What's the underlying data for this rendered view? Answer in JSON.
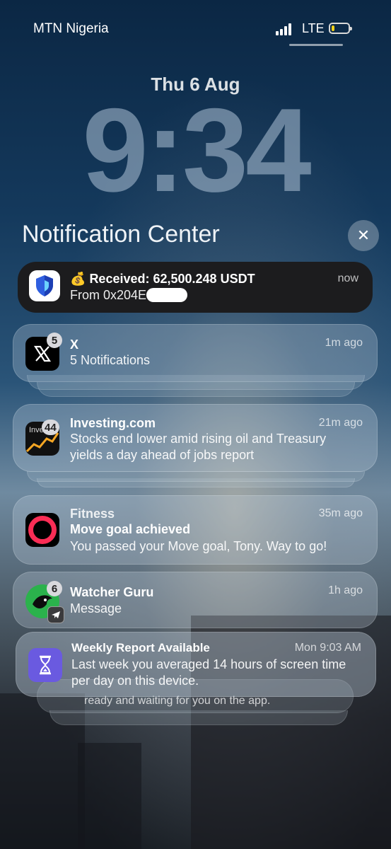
{
  "status_bar": {
    "carrier": "MTN Nigeria",
    "network": "LTE",
    "battery_level": 0.2
  },
  "lock": {
    "date": "Thu 6 Aug",
    "time": "9:34"
  },
  "notification_center": {
    "title": "Notification Center",
    "close_glyph": "✕"
  },
  "notifications": [
    {
      "app_icon": "shield-icon",
      "title_prefix": "💰",
      "title": "Received: 62,500.248 USDT",
      "body": "From 0x204E",
      "time": "now"
    },
    {
      "app": "X",
      "badge": "5",
      "app_icon": "x-logo-icon",
      "title": "X",
      "body": "5 Notifications",
      "time": "1m ago"
    },
    {
      "app": "Investing.com",
      "badge": "44",
      "app_icon": "investing-chart-icon",
      "icon_text": "Inve",
      "title": "Investing.com",
      "body_line1": "Stocks end lower amid rising oil and Treasury",
      "body_line2": "yields a day ahead of jobs report",
      "time": "21m ago"
    },
    {
      "app": "Fitness",
      "app_icon": "activity-ring-icon",
      "title": "Fitness",
      "subtitle": "Move goal achieved",
      "body": "You passed your Move goal, Tony. Way to go!",
      "time": "35m ago"
    },
    {
      "app": "Watcher Guru",
      "badge": "6",
      "app_icon": "watcher-guru-icon",
      "secondary_icon": "telegram-icon",
      "title": "Watcher Guru",
      "body": "Message",
      "time": "1h ago"
    },
    {
      "app": "Screen Time",
      "app_icon": "hourglass-icon",
      "title": "Weekly Report Available",
      "body_line1": "Last week you averaged 14 hours of screen time",
      "body_line2": "per day on this device.",
      "time": "Mon 9:03 AM",
      "peek_text": "ready and waiting for you on the app."
    }
  ],
  "colors": {
    "accent_yellow": "#f2d21a",
    "notification_dark": "#1c1c1e"
  }
}
